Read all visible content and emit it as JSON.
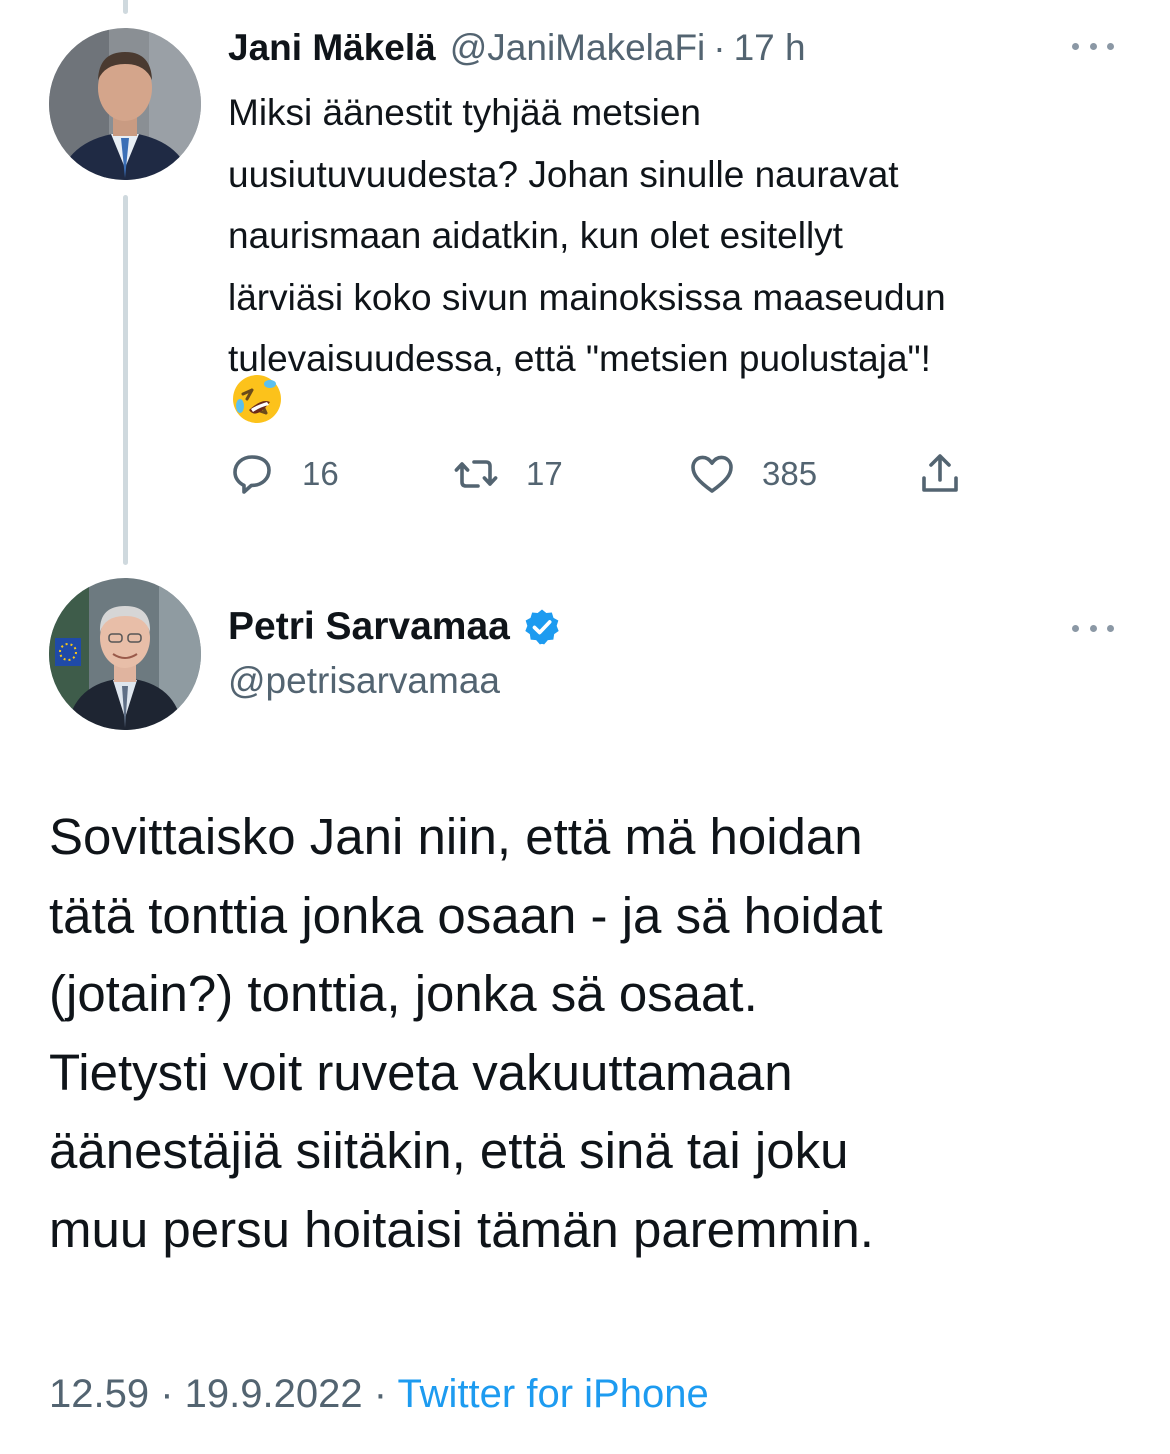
{
  "tweet1": {
    "display_name": "Jani Mäkelä",
    "handle": "@JaniMakelaFi",
    "separator": "·",
    "time": "17 h",
    "text": "Miksi äänestit tyhjää metsien\nuusiutuvuudesta? Johan sinulle nauravat\nnaurismaan aidatkin, kun olet esitellyt\nlärviäsi koko sivun mainoksissa maaseudun\ntulevaisuudessa, että \"metsien puolustaja\"!",
    "emoji": "rolling-on-floor-laughing",
    "actions": {
      "reply_count": "16",
      "retweet_count": "17",
      "like_count": "385"
    },
    "icons": {
      "reply": "reply-icon",
      "retweet": "retweet-icon",
      "like": "heart-icon",
      "share": "share-icon",
      "more": "more-icon"
    }
  },
  "tweet2": {
    "display_name": "Petri Sarvamaa",
    "verified": true,
    "handle": "@petrisarvamaa",
    "text": "Sovittaisko Jani niin, että mä hoidan\ntätä tonttia jonka osaan - ja sä hoidat\n(jotain?) tonttia, jonka sä osaat.\nTietysti voit ruveta vakuuttamaan\näänestäjiä siitäkin, että sinä tai joku\nmuu persu hoitaisi tämän paremmin.",
    "time": "12.59",
    "separator": " · ",
    "date": "19.9.2022",
    "source": "Twitter for iPhone"
  },
  "colors": {
    "text_primary": "#0f1419",
    "text_secondary": "#536471",
    "accent": "#1d9bf0",
    "thread_line": "#cfd9de"
  }
}
